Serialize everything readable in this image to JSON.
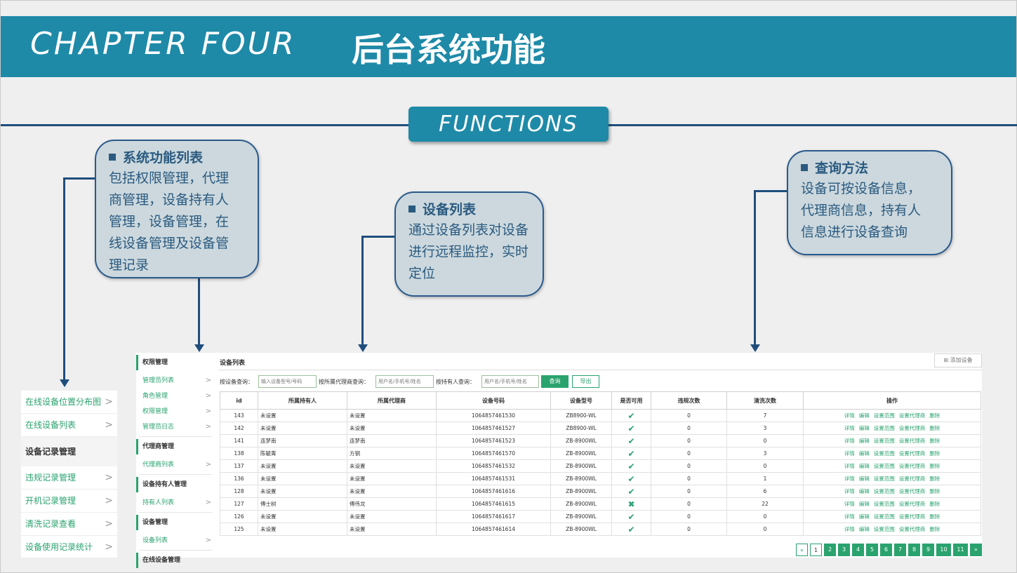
{
  "header": {
    "en": "CHAPTER FOUR",
    "cn": "后台系统功能"
  },
  "functions_label": "FUNCTIONS",
  "bubbles": {
    "b1": {
      "title": "系统功能列表",
      "text": [
        "包括权限管理，代理",
        "商管理，设备持有人",
        "管理，设备管理，在",
        "线设备管理及设备管",
        "理记录"
      ]
    },
    "b2": {
      "title": "设备列表",
      "text": [
        "通过设备列表对设备",
        "进行远程监控，实时",
        "定位"
      ]
    },
    "b3": {
      "title": "查询方法",
      "text": [
        "设备可按设备信息，",
        "代理商信息，持有人",
        "信息进行设备查询"
      ]
    }
  },
  "left_panel": {
    "items1": [
      "在线设备位置分布图",
      "在线设备列表"
    ],
    "head": "设备记录管理",
    "items2": [
      "违规记录管理",
      "开机记录管理",
      "清洗记录查看",
      "设备使用记录统计"
    ]
  },
  "nav": {
    "sections": [
      {
        "head": "权限管理",
        "items": [
          "管理员列表",
          "角色管理",
          "权限管理",
          "管理员日志"
        ]
      },
      {
        "head": "代理商管理",
        "items": [
          "代理商列表"
        ]
      },
      {
        "head": "设备持有人管理",
        "items": [
          "持有人列表"
        ]
      },
      {
        "head": "设备管理",
        "items": [
          "设备列表"
        ]
      },
      {
        "head": "在线设备管理",
        "items": []
      }
    ]
  },
  "main": {
    "title": "设备列表",
    "add_label": "⊞ 添加设备",
    "search": {
      "label1": "按设备查询：",
      "ph1": "输入设备型号/号码",
      "label2": "按所属代理商查询：",
      "ph2": "用户名/手机号/姓名",
      "label3": "按持有人查询：",
      "ph3": "用户名/手机号/姓名",
      "query": "查询",
      "export": "导出"
    },
    "columns": [
      "id",
      "所属持有人",
      "所属代理商",
      "设备号码",
      "设备型号",
      "是否可用",
      "违规次数",
      "清洗次数",
      "操作"
    ],
    "ops": [
      "详情",
      "编辑",
      "设置范围",
      "设置代理商",
      "删除"
    ],
    "rows": [
      {
        "id": "143",
        "owner": "未设置",
        "agent": "未设置",
        "no": "1064857461530",
        "model": "ZB8900-WL",
        "ok": true,
        "vio": "0",
        "wash": "7"
      },
      {
        "id": "142",
        "owner": "未设置",
        "agent": "未设置",
        "no": "1064857461527",
        "model": "ZB8900-WL",
        "ok": true,
        "vio": "0",
        "wash": "3"
      },
      {
        "id": "141",
        "owner": "连梦南",
        "agent": "连梦南",
        "no": "1064857461523",
        "model": "ZB-8900WL",
        "ok": true,
        "vio": "0",
        "wash": "0"
      },
      {
        "id": "138",
        "owner": "陈毓菁",
        "agent": "方钢",
        "no": "1064857461570",
        "model": "ZB-8900WL",
        "ok": true,
        "vio": "0",
        "wash": "3"
      },
      {
        "id": "137",
        "owner": "未设置",
        "agent": "未设置",
        "no": "1064857461532",
        "model": "ZB-8900WL",
        "ok": true,
        "vio": "0",
        "wash": "0"
      },
      {
        "id": "136",
        "owner": "未设置",
        "agent": "未设置",
        "no": "1064857461531",
        "model": "ZB-8900WL",
        "ok": true,
        "vio": "0",
        "wash": "1"
      },
      {
        "id": "128",
        "owner": "未设置",
        "agent": "未设置",
        "no": "1064857461616",
        "model": "ZB-8900WL",
        "ok": true,
        "vio": "0",
        "wash": "6"
      },
      {
        "id": "127",
        "owner": "傅士树",
        "agent": "傅伟龙",
        "no": "1064857461615",
        "model": "ZB-8900WL",
        "ok": false,
        "vio": "0",
        "wash": "22"
      },
      {
        "id": "126",
        "owner": "未设置",
        "agent": "未设置",
        "no": "1064857461617",
        "model": "ZB-8900WL",
        "ok": true,
        "vio": "0",
        "wash": "0"
      },
      {
        "id": "125",
        "owner": "未设置",
        "agent": "未设置",
        "no": "1064857461614",
        "model": "ZB-8900WL",
        "ok": true,
        "vio": "0",
        "wash": "0"
      }
    ],
    "pager": [
      "«",
      "1",
      "2",
      "3",
      "4",
      "5",
      "6",
      "7",
      "8",
      "9",
      "10",
      "11",
      "»"
    ]
  },
  "colors": {
    "teal": "#1e8aa8",
    "navy": "#1f4e7d",
    "green": "#2aa36e",
    "bubble": "#ccd8dd"
  },
  "icons": {
    "check": "check-icon",
    "cross": "cross-icon",
    "chevron": "chevron-right-icon"
  }
}
